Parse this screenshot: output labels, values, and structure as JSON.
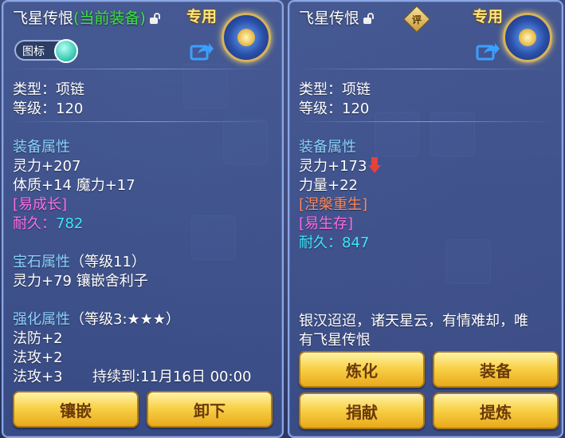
{
  "left_panel": {
    "title": "飞星传恨",
    "current_tag": "(当前装备)",
    "exclusive": "专用",
    "icon_toggle_label": "图标",
    "type_line": "类型：项链",
    "level_line": "等级：120",
    "equip_attr_header": "装备属性",
    "attr1": "灵力+207",
    "attr2": "体质+14 魔力+17",
    "special": "[易成长]",
    "durability_label": "耐久：",
    "durability_value": "782",
    "gem_header": "宝石属性",
    "gem_level": "（等级11）",
    "gem_attr": "灵力+79 镶嵌舍利子",
    "enhance_header": "强化属性",
    "enhance_level": "（等级3:★★★）",
    "enhance1": "法防+2",
    "enhance2": "法攻+2",
    "enhance3": "法攻+3",
    "duration": "持续到:11月16日 00:00",
    "buttons": [
      "镶嵌",
      "卸下"
    ]
  },
  "right_panel": {
    "title": "飞星传恨",
    "rate_badge": "评",
    "exclusive": "专用",
    "type_line": "类型：项链",
    "level_line": "等级：120",
    "equip_attr_header": "装备属性",
    "attr1": "灵力+173",
    "attr2": "力量+22",
    "special1": "[涅槃重生]",
    "special2": "[易生存]",
    "durability_label": "耐久：",
    "durability_value": "847",
    "flavor_text_1": "银汉迢迢，诸天星云，有情难却，唯",
    "flavor_text_2": "有飞星传恨",
    "buttons": [
      "炼化",
      "装备",
      "捐献",
      "提炼"
    ]
  },
  "colors": {
    "green_tag": "#3ee23e",
    "header_blue": "#8ad2ff",
    "magenta": "#ff6ee6",
    "cyan": "#3ee6ff",
    "orange": "#ff8a5a",
    "button_gold": "#f8d24a",
    "arrow_red": "#e8403a"
  },
  "icons": {
    "lock": "unlock-icon",
    "share": "share-icon",
    "down_arrow": "down-arrow-icon",
    "item": "necklace-item-icon"
  }
}
